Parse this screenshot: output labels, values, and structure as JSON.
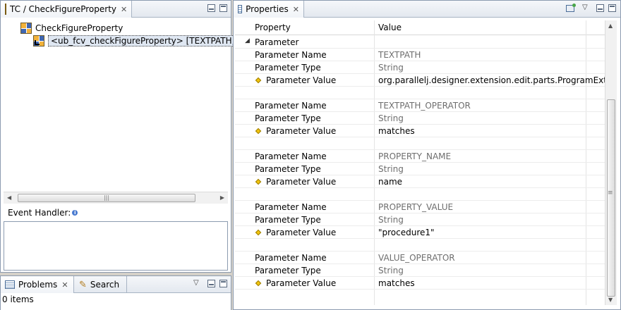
{
  "left_view": {
    "tab_title": "TC / CheckFigureProperty",
    "tree": [
      {
        "label": "CheckFigureProperty"
      },
      {
        "label": "<ub_fcv_checkFigureProperty> [TEXTPATH; TEX"
      }
    ],
    "event_handler_label": "Event Handler:",
    "info_glyph": "i"
  },
  "bottom_view": {
    "tabs": [
      {
        "label": "Problems"
      },
      {
        "label": "Search"
      }
    ],
    "status": "0 items"
  },
  "properties_view": {
    "tab_title": "Properties",
    "columns": {
      "property": "Property",
      "value": "Value"
    },
    "group_label": "Parameter",
    "parameters": [
      {
        "name_key": "Parameter Name",
        "name": "TEXTPATH",
        "type_key": "Parameter Type",
        "type": "String",
        "value_key": "Parameter Value",
        "value": "org.parallelj.designer.extension.edit.parts.ProgramExt..."
      },
      {
        "name_key": "Parameter Name",
        "name": "TEXTPATH_OPERATOR",
        "type_key": "Parameter Type",
        "type": "String",
        "value_key": "Parameter Value",
        "value": "matches"
      },
      {
        "name_key": "Parameter Name",
        "name": "PROPERTY_NAME",
        "type_key": "Parameter Type",
        "type": "String",
        "value_key": "Parameter Value",
        "value": "name"
      },
      {
        "name_key": "Parameter Name",
        "name": "PROPERTY_VALUE",
        "type_key": "Parameter Type",
        "type": "String",
        "value_key": "Parameter Value",
        "value": "\"procedure1\""
      },
      {
        "name_key": "Parameter Name",
        "name": "VALUE_OPERATOR",
        "type_key": "Parameter Type",
        "type": "String",
        "value_key": "Parameter Value",
        "value": "matches"
      }
    ]
  },
  "icons": {
    "tc_view": "test-case-icon",
    "properties_view": "properties-icon",
    "problems_view": "problems-icon",
    "search_view": "search-icon",
    "tree_node": "figure-node-icon",
    "property_value": "diamond-icon"
  },
  "colors": {
    "tab_border": "#a8b4c4",
    "selection": "#dfe7f2",
    "diamond": "#f2c40d"
  }
}
